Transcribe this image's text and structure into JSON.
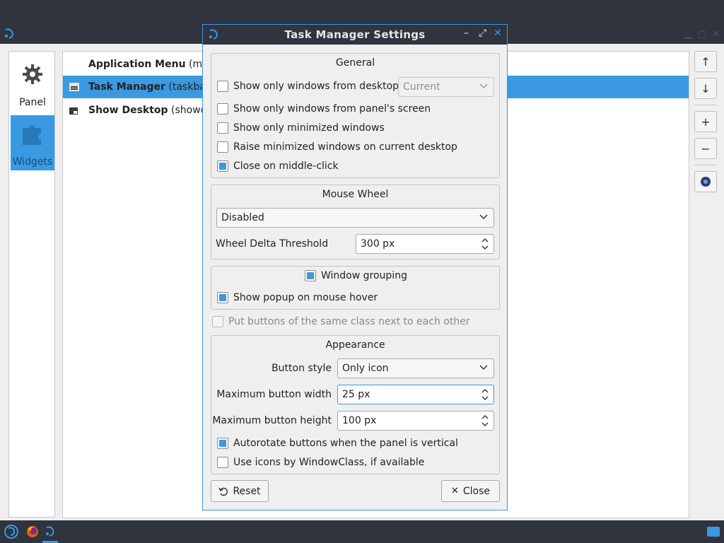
{
  "background_window": {
    "sidebar": [
      {
        "label": "Panel"
      },
      {
        "label": "Widgets"
      }
    ],
    "plugins": [
      {
        "name": "Application Menu",
        "id": " (mai"
      },
      {
        "name": "Task Manager",
        "id": " (taskbar"
      },
      {
        "name": "Show Desktop",
        "id": " (showde"
      }
    ]
  },
  "dialog": {
    "title": "Task Manager Settings",
    "general": {
      "title": "General",
      "only_desktop": {
        "label": "Show only windows from desktop",
        "checked": false
      },
      "desktop_combo": "Current",
      "only_screen": {
        "label": "Show only windows from panel's screen",
        "checked": false
      },
      "only_minimized": {
        "label": "Show only minimized windows",
        "checked": false
      },
      "raise_minimized": {
        "label": "Raise minimized windows on current desktop",
        "checked": false
      },
      "close_middle": {
        "label": "Close on middle-click",
        "checked": true
      }
    },
    "mouse_wheel": {
      "title": "Mouse Wheel",
      "mode": "Disabled",
      "threshold_label": "Wheel Delta Threshold",
      "threshold_value": "300 px"
    },
    "grouping": {
      "title": "Window grouping",
      "enabled": true,
      "popup_hover": {
        "label": "Show popup on mouse hover",
        "checked": true
      }
    },
    "same_class": {
      "label": "Put buttons of the same class next to each other",
      "checked": false
    },
    "appearance": {
      "title": "Appearance",
      "style_label": "Button style",
      "style_value": "Only icon",
      "max_width_label": "Maximum button width",
      "max_width_value": "25 px",
      "max_height_label": "Maximum button height",
      "max_height_value": "100 px",
      "autorotate": {
        "label": "Autorotate buttons when the panel is vertical",
        "checked": true
      },
      "windowclass": {
        "label": "Use icons by WindowClass, if available",
        "checked": false
      }
    },
    "reset_label": "Reset",
    "close_label": "Close"
  },
  "colors": {
    "accent": "#3a99e0",
    "titlebar": "#2f343f",
    "window_bg": "#efefef"
  }
}
